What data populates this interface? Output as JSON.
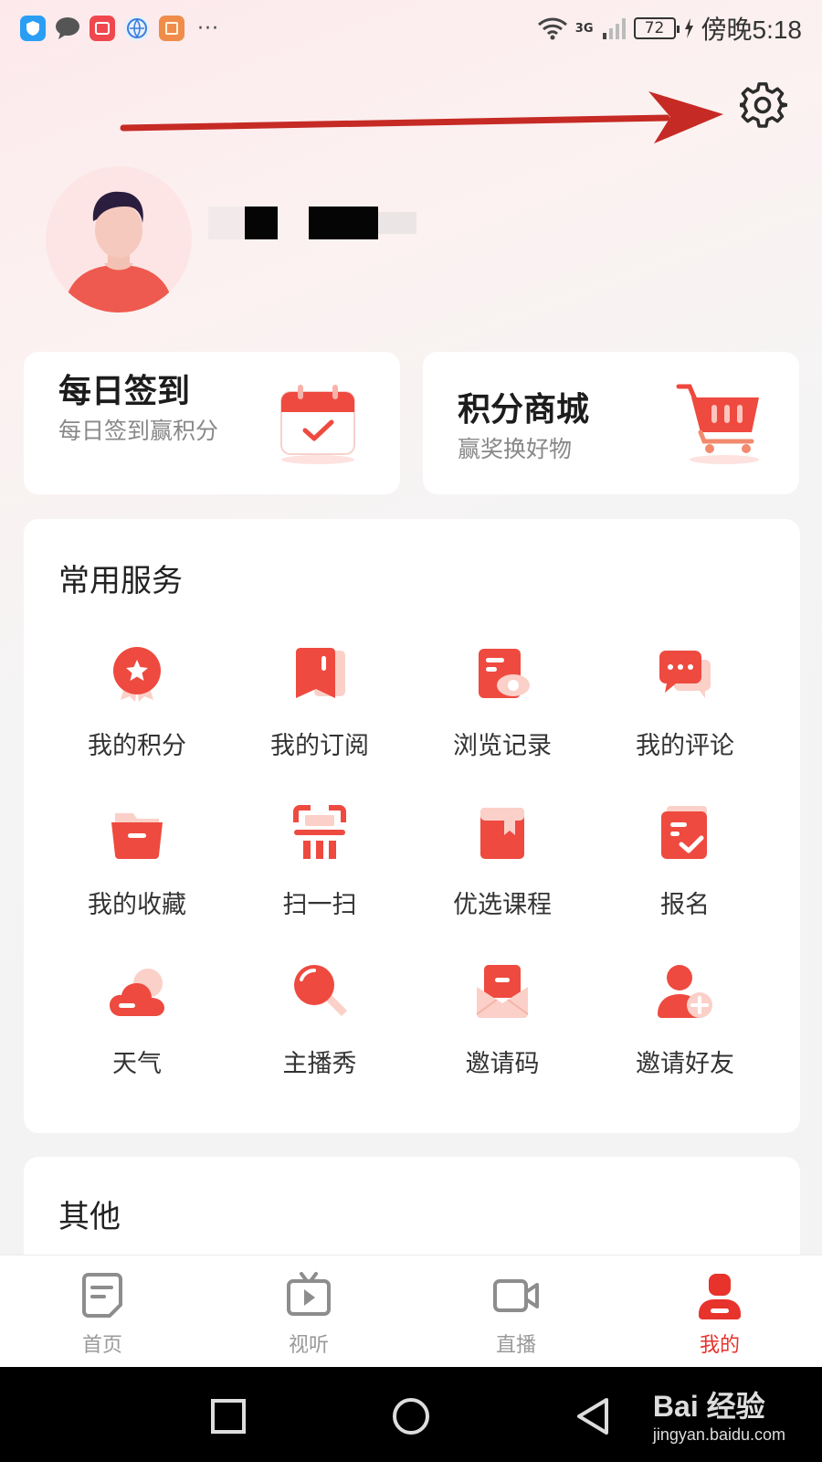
{
  "status_bar": {
    "time": "傍晚5:18",
    "battery": "72",
    "network": "3G",
    "more": "···"
  },
  "promo_cards": [
    {
      "title": "每日签到",
      "subtitle": "每日签到赢积分",
      "icon": "calendar-check-icon"
    },
    {
      "title": "积分商城",
      "subtitle": "赢奖换好物",
      "icon": "shopping-cart-icon"
    }
  ],
  "services": {
    "title": "常用服务",
    "items": [
      {
        "label": "我的积分",
        "icon": "medal-icon"
      },
      {
        "label": "我的订阅",
        "icon": "bookmark-icon"
      },
      {
        "label": "浏览记录",
        "icon": "history-eye-icon"
      },
      {
        "label": "我的评论",
        "icon": "comment-icon"
      },
      {
        "label": "我的收藏",
        "icon": "folder-icon"
      },
      {
        "label": "扫一扫",
        "icon": "scan-icon"
      },
      {
        "label": "优选课程",
        "icon": "course-book-icon"
      },
      {
        "label": "报名",
        "icon": "signup-clipboard-icon"
      },
      {
        "label": "天气",
        "icon": "cloud-icon"
      },
      {
        "label": "主播秀",
        "icon": "microphone-icon"
      },
      {
        "label": "邀请码",
        "icon": "envelope-icon"
      },
      {
        "label": "邀请好友",
        "icon": "add-friend-icon"
      }
    ]
  },
  "others": {
    "title": "其他"
  },
  "bottom_nav": [
    {
      "label": "首页",
      "icon": "home-doc-icon",
      "active": false
    },
    {
      "label": "视听",
      "icon": "video-play-icon",
      "active": false
    },
    {
      "label": "直播",
      "icon": "live-camera-icon",
      "active": false
    },
    {
      "label": "我的",
      "icon": "profile-icon",
      "active": true
    }
  ],
  "watermark": {
    "brand": "Bai  经验",
    "url": "jingyan.baidu.com"
  },
  "colors": {
    "accent": "#e8322c",
    "icon_red": "#f0473d",
    "icon_light": "#fbd0c8"
  }
}
